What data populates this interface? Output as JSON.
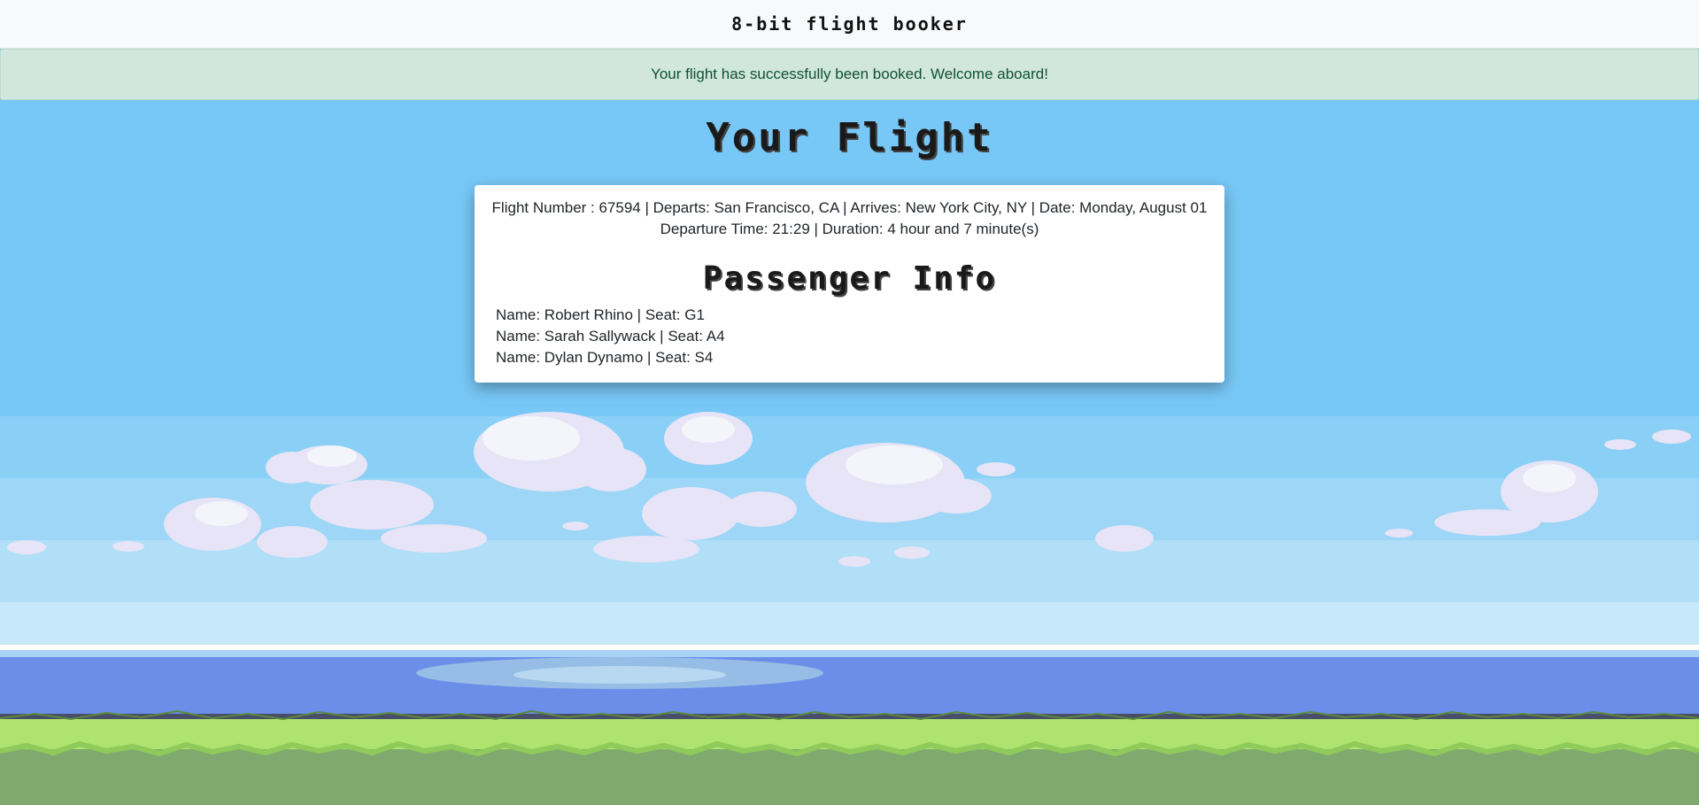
{
  "header": {
    "brand": "8-bit flight booker"
  },
  "alert": {
    "message": "Your flight has successfully been booked. Welcome aboard!",
    "color": "#d1e7dd"
  },
  "main": {
    "title": "Your Flight"
  },
  "flight": {
    "summary_line1": "Flight Number : 67594 | Departs: San Francisco, CA | Arrives: New York City, NY | Date: Monday, August 01",
    "summary_line2": "Departure Time: 21:29 | Duration: 4 hour and 7 minute(s)"
  },
  "passengers": {
    "title": "Passenger Info",
    "items": [
      "Name: Robert Rhino | Seat: G1",
      "Name: Sarah Sallywack | Seat: A4",
      "Name: Dylan Dynamo | Seat: S4"
    ]
  },
  "colors": {
    "sky": "#78c8f6",
    "water": "#6b8ee8",
    "grass": "#aee36f",
    "ground": "#7fa96f"
  }
}
